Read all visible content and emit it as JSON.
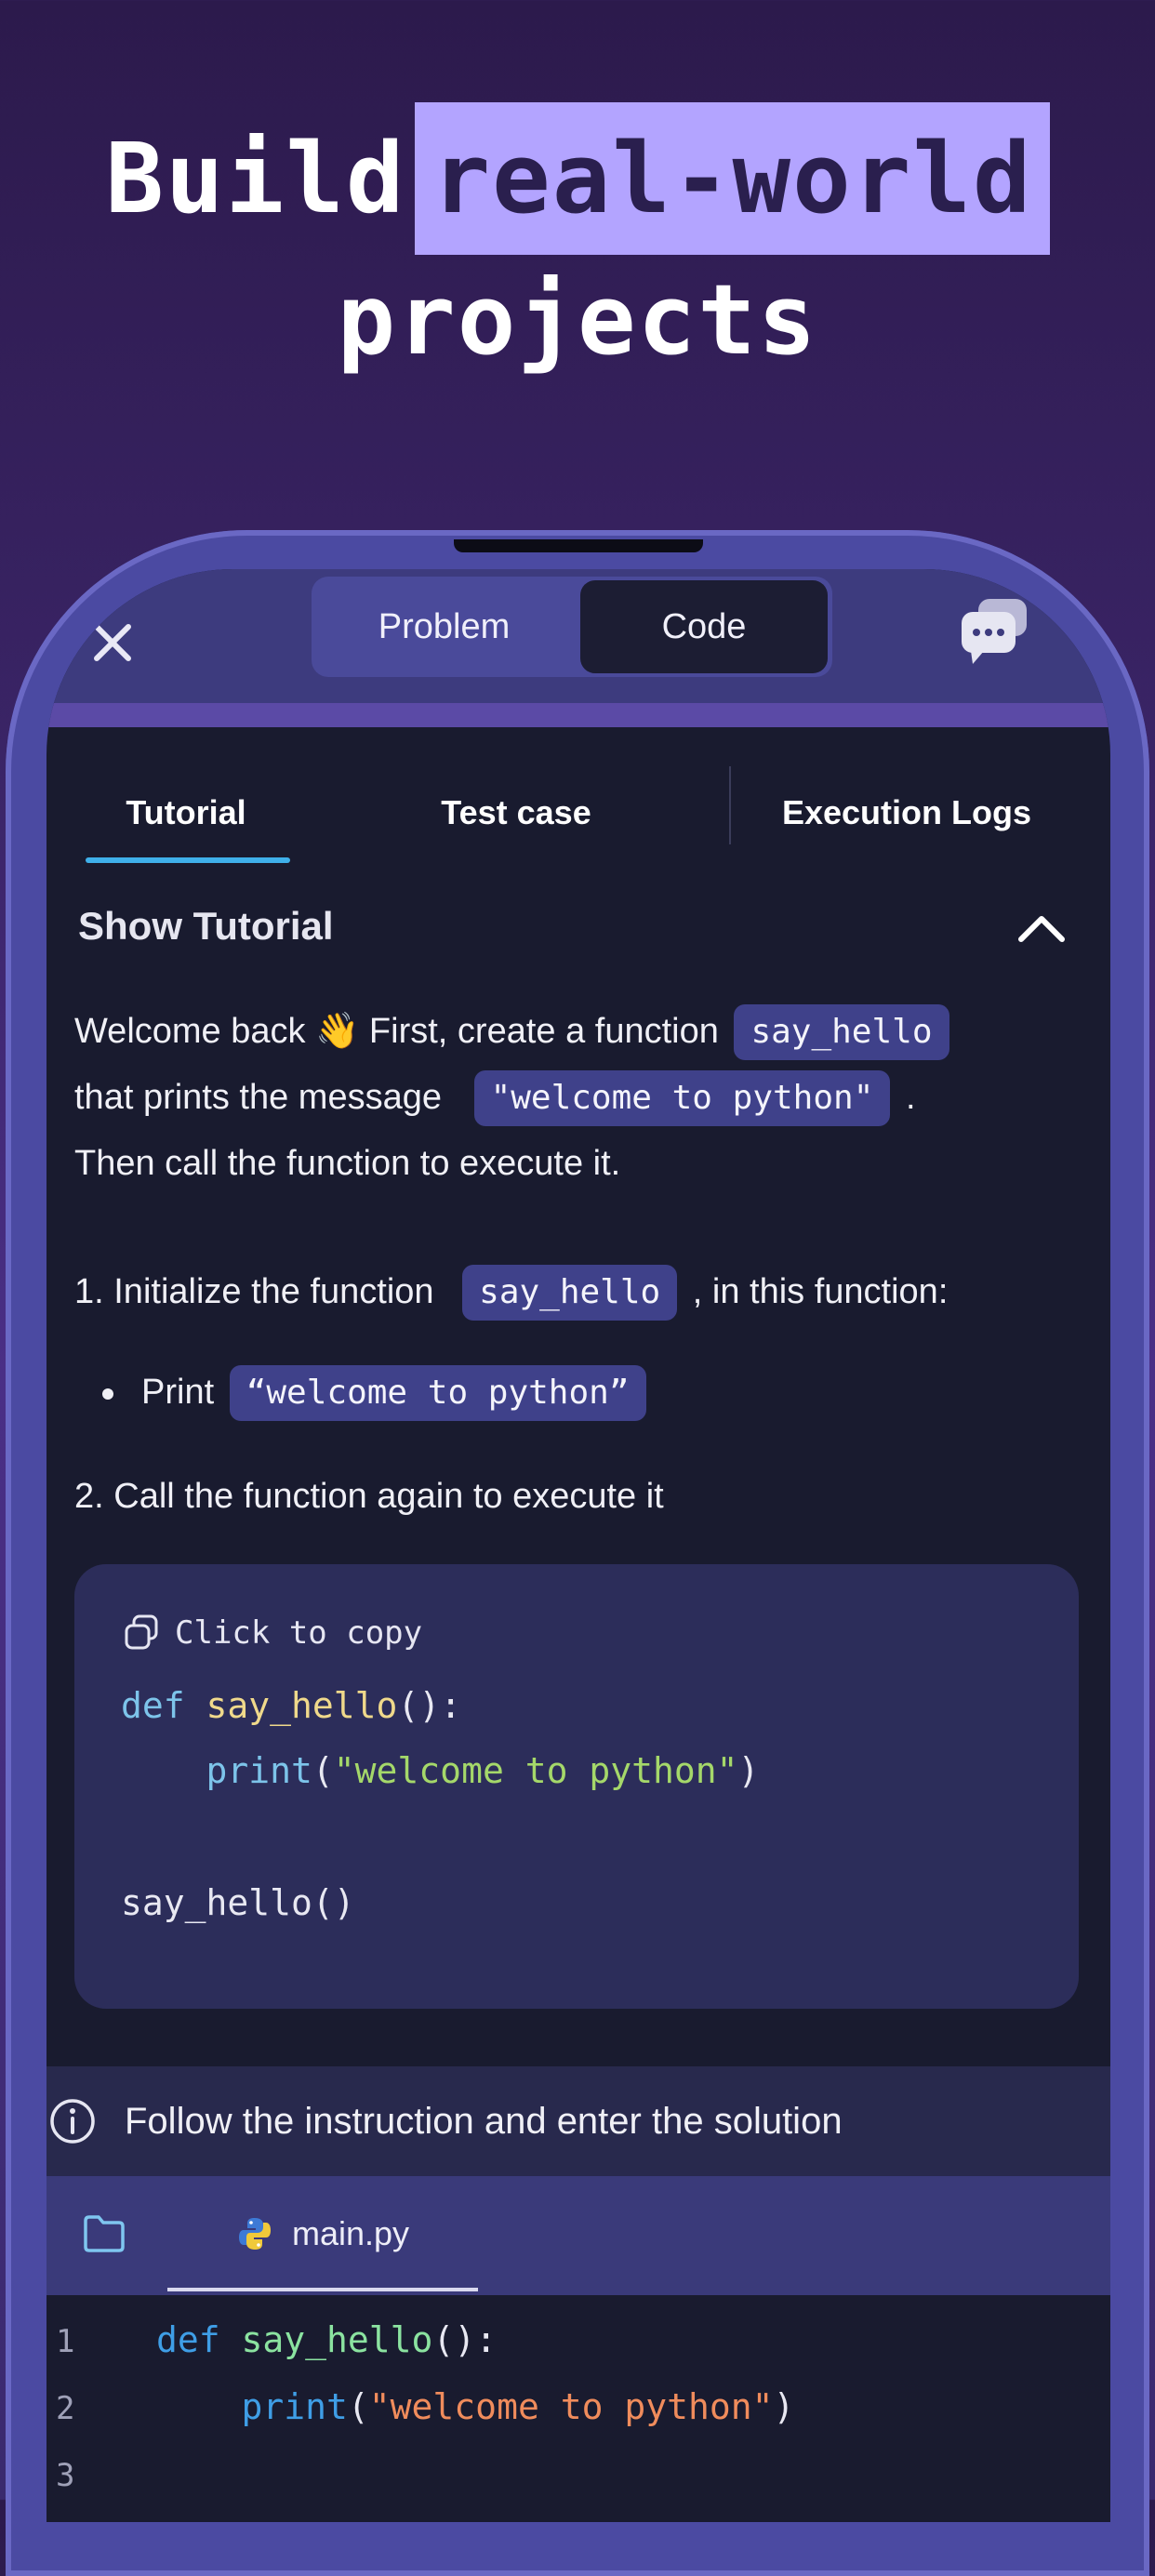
{
  "headline": {
    "line1_plain": "Build",
    "line1_highlight": "real-world",
    "line2": "projects"
  },
  "topbar": {
    "segments": [
      "Problem",
      "Code"
    ],
    "selected_segment": "Code"
  },
  "tabs": [
    "Tutorial",
    "Test case",
    "Execution Logs"
  ],
  "active_tab": "Tutorial",
  "tutorial": {
    "header": "Show Tutorial",
    "para1_a": "Welcome back 👋 First, create a function",
    "para1_chip1": "say_hello",
    "para1_b": "that prints the message",
    "para1_chip2": "\"welcome to python\"",
    "para1_c": ".",
    "para1_d": "Then call the function to execute it.",
    "step1_a": "1. Initialize the function",
    "step1_chip": "say_hello",
    "step1_b": ", in this function:",
    "bullet_label": "Print",
    "bullet_chip": "“welcome to python”",
    "step2": "2. Call the function again to execute it"
  },
  "code_card": {
    "copy_label": "Click to copy",
    "line1_kw": "def",
    "line1_fn": "say_hello",
    "line1_rest": "():",
    "line2_fn": "print",
    "line2_open": "(",
    "line2_str": "\"welcome to python\"",
    "line2_close": ")",
    "line4": "say_hello()"
  },
  "info_banner": {
    "text": "Follow the instruction and enter the solution"
  },
  "editor": {
    "file_name": "main.py",
    "line_numbers": [
      "1",
      "2",
      "3"
    ],
    "line1_kw": "def",
    "line1_fn": "say_hello",
    "line1_rest": "():",
    "line2_fn": "print",
    "line2_open": "(",
    "line2_str": "\"welcome to python\"",
    "line2_close": ")"
  },
  "colors": {
    "accent_tab_underline": "#3fb0ea",
    "highlight": "#b3a4ff"
  }
}
